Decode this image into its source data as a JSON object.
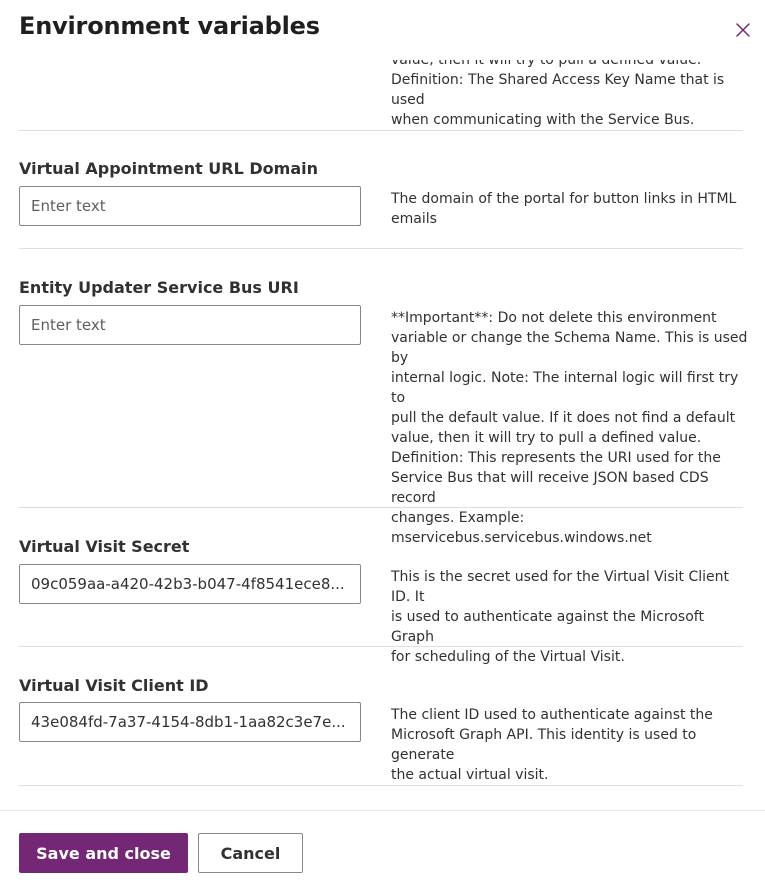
{
  "panel": {
    "title": "Environment variables",
    "close_icon": "close-icon"
  },
  "top_fragment": {
    "description": "value, then it will try to pull a defined value.\nDefinition: The Shared Access Key Name that is used\nwhen communicating with the Service Bus."
  },
  "fields": [
    {
      "label": "Virtual Appointment URL Domain",
      "value": "",
      "placeholder": "Enter text",
      "description": "The domain of the portal for button links in HTML\nemails"
    },
    {
      "label": "Entity Updater Service Bus URI",
      "value": "",
      "placeholder": "Enter text",
      "description": "**Important**: Do not delete this environment\nvariable or change the Schema Name. This is used by\ninternal logic. Note: The internal logic will first try to\npull the default value. If it does not find a default\nvalue, then it will try to pull a defined value.\nDefinition: This represents the URI used for the\nService Bus that will receive JSON based CDS record\nchanges. Example:\nmservicebus.servicebus.windows.net"
    },
    {
      "label": "Virtual Visit Secret",
      "value": "09c059aa-a420-42b3-b047-4f8541ece8...",
      "placeholder": "",
      "description": "This is the secret used for the Virtual Visit Client ID. It\nis used to authenticate against the Microsoft Graph\nfor scheduling of the Virtual Visit."
    },
    {
      "label": "Virtual Visit Client ID",
      "value": "43e084fd-7a37-4154-8db1-1aa82c3e7e...",
      "placeholder": "",
      "description": "The client ID used to authenticate against the\nMicrosoft Graph API. This identity is used to generate\nthe actual virtual visit."
    }
  ],
  "footer": {
    "save_label": "Save and close",
    "cancel_label": "Cancel"
  },
  "colors": {
    "primary": "#742774",
    "divider": "#e1dfdd",
    "input_border": "#8a8886"
  }
}
